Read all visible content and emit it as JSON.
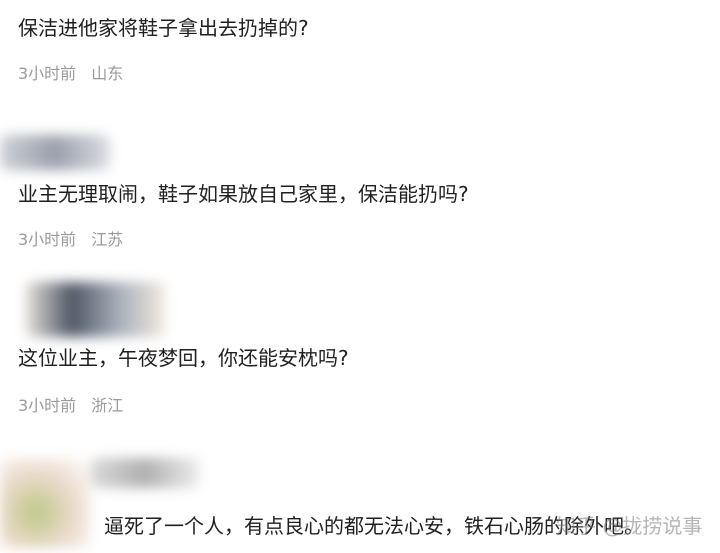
{
  "comments": [
    {
      "text": "保洁进他家将鞋子拿出去扔掉的?",
      "time": "3小时前",
      "location": "山东"
    },
    {
      "text": "业主无理取闹，鞋子如果放自己家里，保洁能扔吗?",
      "time": "3小时前",
      "location": "江苏"
    },
    {
      "text": "这位业主，午夜梦回，你还能安枕吗?",
      "time": "3小时前",
      "location": "浙江"
    },
    {
      "text": "逼死了一个人，有点良心的都无法心安，铁石心肠的除外吧。"
    }
  ],
  "watermark": {
    "text": "知乎 @拢捞说事"
  },
  "colors": {
    "text": "#1f1f1f",
    "meta": "#9a9a9a",
    "background": "#ffffff"
  }
}
